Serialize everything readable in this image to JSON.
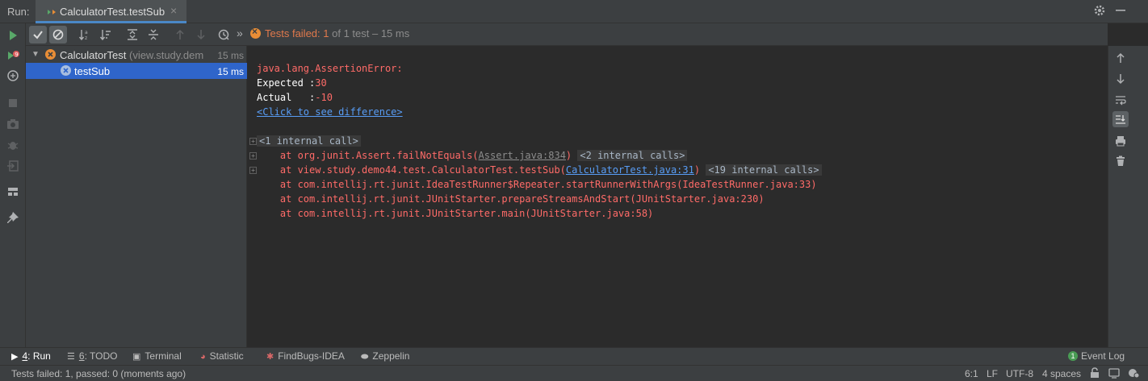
{
  "header": {
    "run_label": "Run:",
    "tab_label": "CalculatorTest.testSub",
    "tab_close": "×"
  },
  "toolbar": {
    "more": "»",
    "status_prefix": "Tests failed: ",
    "failed_count": "1",
    "status_suffix": " of 1 test – 15 ms"
  },
  "tree": {
    "root": {
      "name": "CalculatorTest",
      "package": " (view.study.dem",
      "time": "15 ms"
    },
    "child": {
      "name": "testSub",
      "time": "15 ms"
    }
  },
  "console": {
    "error_line": "java.lang.AssertionError:",
    "expected_label": "Expected :",
    "expected_value": "30",
    "actual_label": "Actual   :",
    "actual_value": "-10",
    "diff_link": "<Click to see difference>",
    "internal_call_1": "<1 internal call>",
    "trace1_prefix": "    at org.junit.Assert.failNotEquals(",
    "trace1_link": "Assert.java:834",
    "trace1_suffix": ")",
    "trace1_fold": "<2 internal calls>",
    "trace2_prefix": "    at view.study.demo44.test.CalculatorTest.testSub(",
    "trace2_link": "CalculatorTest.java:31",
    "trace2_suffix": ")",
    "trace2_fold": "<19 internal calls>",
    "trace3": "    at com.intellij.rt.junit.IdeaTestRunner$Repeater.startRunnerWithArgs(IdeaTestRunner.java:33)",
    "trace4": "    at com.intellij.rt.junit.JUnitStarter.prepareStreamsAndStart(JUnitStarter.java:230)",
    "trace5": "    at com.intellij.rt.junit.JUnitStarter.main(JUnitStarter.java:58)"
  },
  "bottom_tabs": {
    "run_num": "4",
    "run_label": ": Run",
    "todo_num": "6",
    "todo_label": ": TODO",
    "terminal": "Terminal",
    "statistic": "Statistic",
    "findbugs": "FindBugs-IDEA",
    "zeppelin": "Zeppelin",
    "event_count": "1",
    "event_log": "Event Log"
  },
  "statusbar": {
    "message": "Tests failed: 1, passed: 0 (moments ago)",
    "position": "6:1",
    "line_sep": "LF",
    "encoding": "UTF-8",
    "indent": "4 spaces"
  },
  "icons": {
    "run": "play-icon",
    "rerun_failed": "rerun-failed-icon",
    "debug": "debug-icon",
    "stop": "stop-icon",
    "snapshot": "camera-icon",
    "bug": "bug-icon",
    "exit": "exit-icon",
    "layout": "layout-icon",
    "pin": "pin-icon",
    "settings": "gear-icon",
    "minimize": "minimize-icon"
  },
  "colors": {
    "failed": "#e0794c",
    "error_text": "#ff6b68",
    "link": "#589df6",
    "selection": "#2f65ca",
    "run_green": "#59a869"
  }
}
